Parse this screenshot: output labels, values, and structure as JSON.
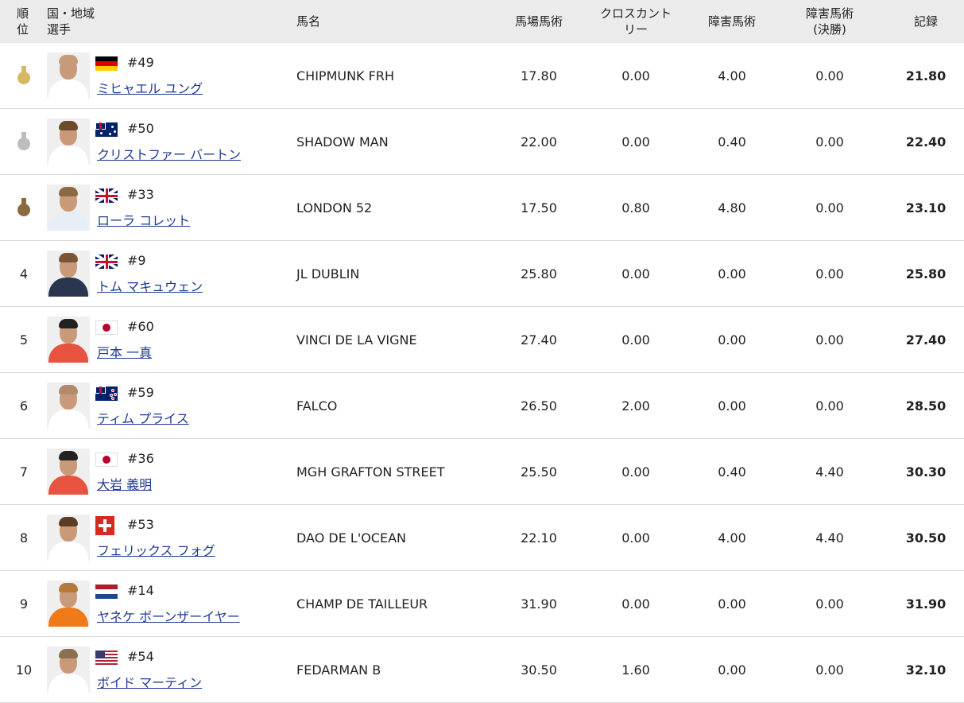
{
  "header": {
    "rank": "順\n位",
    "country_athlete": "国・地域\n選手",
    "horse": "馬名",
    "dressage": "馬場馬術",
    "cross_country": "クロスカント\nリー",
    "jumping": "障害馬術",
    "jumping_final": "障害馬術\n(決勝)",
    "total": "記録"
  },
  "rows": [
    {
      "rank": "",
      "medal": "gold",
      "flag": "de",
      "bib": "#49",
      "athlete": "ミヒャエル ユング",
      "horse": "CHIPMUNK FRH",
      "dressage": "17.80",
      "xc": "0.00",
      "jumping": "4.00",
      "jumping_final": "0.00",
      "total": "21.80"
    },
    {
      "rank": "",
      "medal": "silver",
      "flag": "au",
      "bib": "#50",
      "athlete": "クリストファー バートン",
      "horse": "SHADOW MAN",
      "dressage": "22.00",
      "xc": "0.00",
      "jumping": "0.40",
      "jumping_final": "0.00",
      "total": "22.40"
    },
    {
      "rank": "",
      "medal": "bronze",
      "flag": "gb",
      "bib": "#33",
      "athlete": "ローラ コレット",
      "horse": "LONDON 52",
      "dressage": "17.50",
      "xc": "0.80",
      "jumping": "4.80",
      "jumping_final": "0.00",
      "total": "23.10"
    },
    {
      "rank": "4",
      "medal": "",
      "flag": "gb",
      "bib": "#9",
      "athlete": "トム マキュウェン",
      "horse": "JL DUBLIN",
      "dressage": "25.80",
      "xc": "0.00",
      "jumping": "0.00",
      "jumping_final": "0.00",
      "total": "25.80"
    },
    {
      "rank": "5",
      "medal": "",
      "flag": "jp",
      "bib": "#60",
      "athlete": "戸本 一真",
      "horse": "VINCI DE LA VIGNE",
      "dressage": "27.40",
      "xc": "0.00",
      "jumping": "0.00",
      "jumping_final": "0.00",
      "total": "27.40"
    },
    {
      "rank": "6",
      "medal": "",
      "flag": "nz",
      "bib": "#59",
      "athlete": "ティム プライス",
      "horse": "FALCO",
      "dressage": "26.50",
      "xc": "2.00",
      "jumping": "0.00",
      "jumping_final": "0.00",
      "total": "28.50"
    },
    {
      "rank": "7",
      "medal": "",
      "flag": "jp",
      "bib": "#36",
      "athlete": "大岩 義明",
      "horse": "MGH GRAFTON STREET",
      "dressage": "25.50",
      "xc": "0.00",
      "jumping": "0.40",
      "jumping_final": "4.40",
      "total": "30.30"
    },
    {
      "rank": "8",
      "medal": "",
      "flag": "ch",
      "bib": "#53",
      "athlete": "フェリックス フォグ",
      "horse": "DAO DE L'OCEAN",
      "dressage": "22.10",
      "xc": "0.00",
      "jumping": "4.00",
      "jumping_final": "4.40",
      "total": "30.50"
    },
    {
      "rank": "9",
      "medal": "",
      "flag": "nl",
      "bib": "#14",
      "athlete": "ヤネケ ボーンザーイヤー",
      "horse": "CHAMP DE TAILLEUR",
      "dressage": "31.90",
      "xc": "0.00",
      "jumping": "0.00",
      "jumping_final": "0.00",
      "total": "31.90"
    },
    {
      "rank": "10",
      "medal": "",
      "flag": "us",
      "bib": "#54",
      "athlete": "ボイド マーティン",
      "horse": "FEDARMAN B",
      "dressage": "30.50",
      "xc": "1.60",
      "jumping": "0.00",
      "jumping_final": "0.00",
      "total": "32.10"
    }
  ],
  "colors": {
    "gold": "#d4b863",
    "silver": "#bdbdbd",
    "bronze": "#8c6a3d",
    "link": "#1f3a93",
    "header_bg": "#ebebeb"
  },
  "avatars": [
    {
      "shirt": "#ffffff",
      "hair": "#c99a7a"
    },
    {
      "shirt": "#ffffff",
      "hair": "#6b4a2b"
    },
    {
      "shirt": "#e8eef5",
      "hair": "#8a6a45"
    },
    {
      "shirt": "#2a3550",
      "hair": "#7a5535"
    },
    {
      "shirt": "#e8533f",
      "hair": "#222222"
    },
    {
      "shirt": "#ffffff",
      "hair": "#b08a6a"
    },
    {
      "shirt": "#e8533f",
      "hair": "#222222"
    },
    {
      "shirt": "#ffffff",
      "hair": "#5a3d25"
    },
    {
      "shirt": "#f07a1a",
      "hair": "#b5793a"
    },
    {
      "shirt": "#ffffff",
      "hair": "#8a7050"
    }
  ]
}
